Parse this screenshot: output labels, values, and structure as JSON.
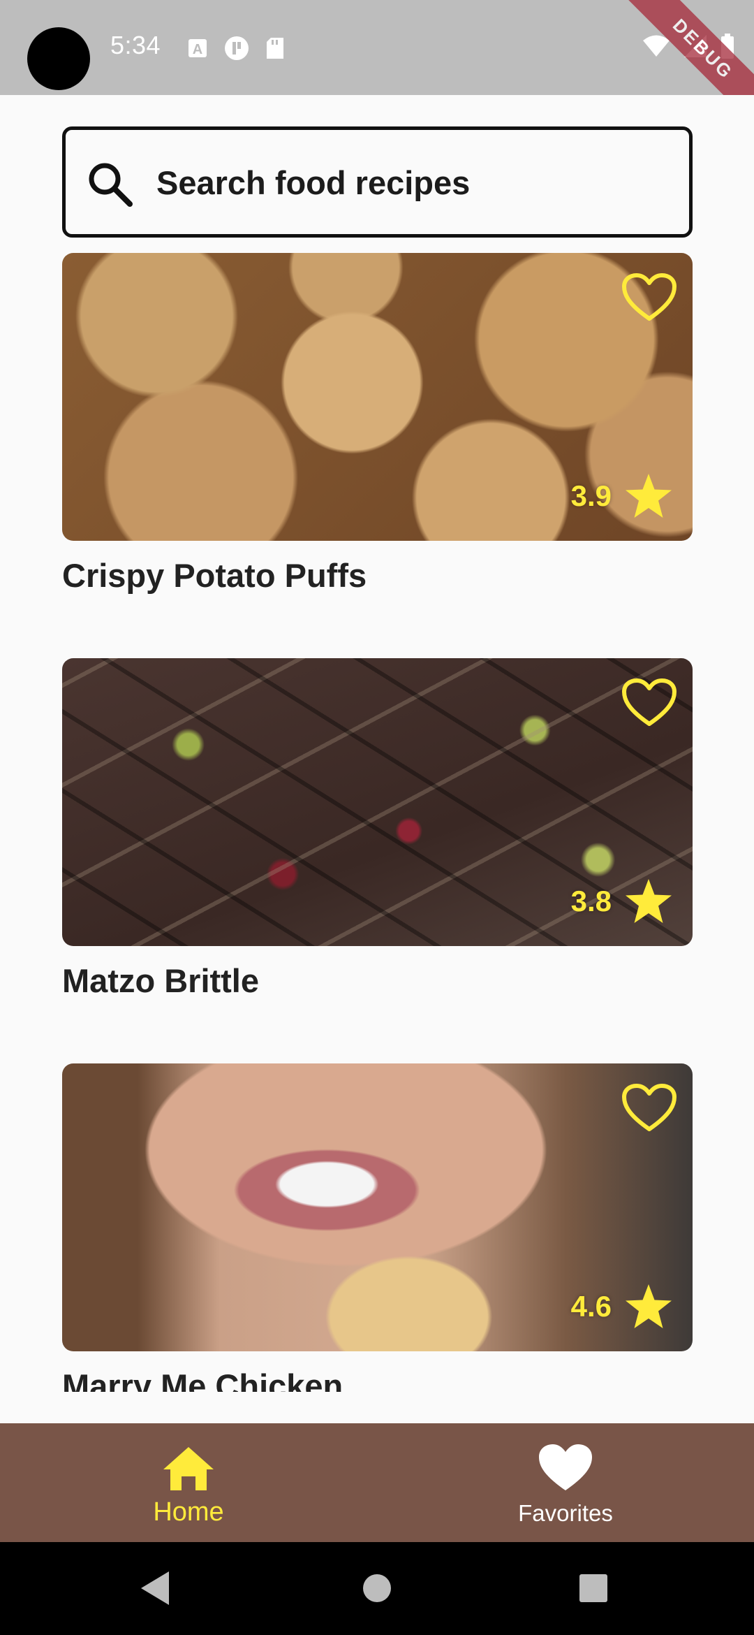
{
  "status_bar": {
    "time": "5:34",
    "debug_label": "DEBUG",
    "icons_left": [
      "text-a-icon",
      "circle-p-icon",
      "sd-card-icon"
    ],
    "icons_right": [
      "wifi-icon",
      "signal-icon",
      "battery-icon"
    ]
  },
  "search": {
    "placeholder": "Search food recipes"
  },
  "recipes": [
    {
      "title": "Crispy Potato Puffs",
      "rating": "3.9",
      "favorite": false
    },
    {
      "title": "Matzo Brittle",
      "rating": "3.8",
      "favorite": false
    },
    {
      "title": "Marry Me Chicken",
      "rating": "4.6",
      "favorite": false
    }
  ],
  "bottom_nav": {
    "home_label": "Home",
    "favorites_label": "Favorites",
    "active": "home"
  },
  "colors": {
    "accent": "#ffeb3b",
    "nav_background": "#795548",
    "status_bar": "#bdbdbd"
  }
}
